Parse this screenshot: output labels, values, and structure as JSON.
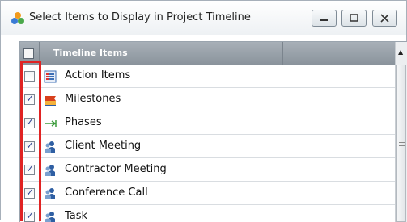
{
  "window": {
    "title": "Select Items to Display in Project Timeline"
  },
  "grid": {
    "column_header": "Timeline Items",
    "rows": [
      {
        "label": "Action Items",
        "checked": false,
        "icon": "action-items-icon"
      },
      {
        "label": "Milestones",
        "checked": true,
        "icon": "milestone-flag-icon"
      },
      {
        "label": "Phases",
        "checked": true,
        "icon": "phase-arrow-icon"
      },
      {
        "label": "Client Meeting",
        "checked": true,
        "icon": "meeting-people-icon"
      },
      {
        "label": "Contractor Meeting",
        "checked": true,
        "icon": "meeting-people-icon"
      },
      {
        "label": "Conference Call",
        "checked": true,
        "icon": "meeting-people-icon"
      },
      {
        "label": "Task",
        "checked": true,
        "icon": "meeting-people-icon"
      }
    ]
  },
  "colors": {
    "header_bg": "#8a939c",
    "highlight_border": "#e02323",
    "check_mark": "#2a3f8f"
  }
}
